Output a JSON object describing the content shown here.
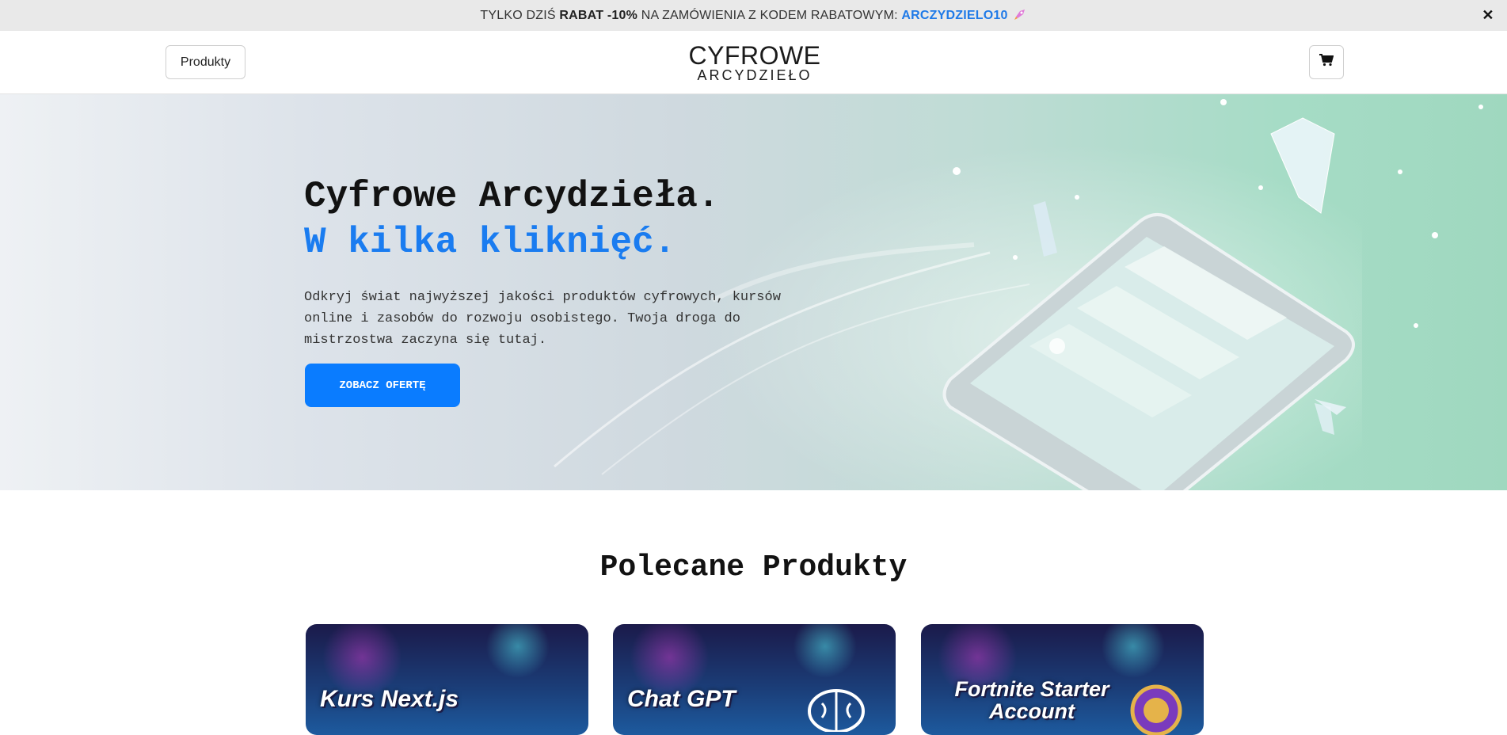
{
  "promo": {
    "prefix": "TYLKO DZIŚ",
    "discount": "RABAT -10%",
    "middle": "NA ZAMÓWIENIA Z KODEM RABATOWYM:",
    "code": "ARCZYDZIELO10",
    "icon": "rocket-icon",
    "close_icon": "close-icon",
    "close_label": "✕"
  },
  "header": {
    "products_label": "Produkty",
    "logo_top": "CYFROWE",
    "logo_bottom": "ARCYDZIEŁO",
    "cart_icon": "cart-icon"
  },
  "hero": {
    "title_line1": "Cyfrowe Arcydzieła.",
    "title_line2": "W kilka kliknięć.",
    "description": "Odkryj świat najwyższej jakości produktów cyfrowych, kursów online i zasobów do rozwoju osobistego. Twoja droga do mistrzostwa zaczyna się tutaj.",
    "cta_label": "ZOBACZ OFERTĘ"
  },
  "featured": {
    "title": "Polecane Produkty",
    "products": [
      {
        "title": "Kurs Next.js"
      },
      {
        "title": "Chat GPT"
      },
      {
        "title": "Fortnite Starter Account"
      }
    ]
  },
  "colors": {
    "accent": "#0a7cff",
    "promo_bg": "#e9e9e9"
  }
}
